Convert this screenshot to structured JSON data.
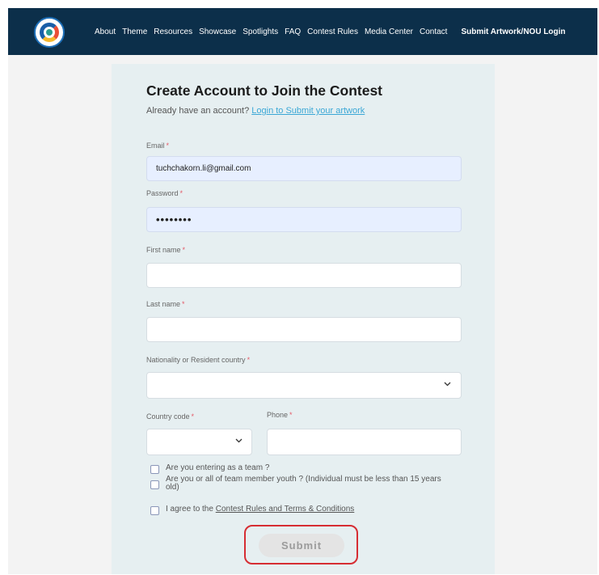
{
  "nav": {
    "items": [
      "About",
      "Theme",
      "Resources",
      "Showcase",
      "Spotlights",
      "FAQ",
      "Contest Rules",
      "Media Center",
      "Contact"
    ],
    "login": "Submit Artwork/NOU Login"
  },
  "form": {
    "title": "Create Account to Join the Contest",
    "already": "Already have an account?",
    "login_link": "Login to Submit your artwork",
    "email": {
      "label": "Email",
      "value": "tuchchakorn.li@gmail.com"
    },
    "password": {
      "label": "Password",
      "value": "••••••••"
    },
    "first_name": {
      "label": "First name",
      "value": ""
    },
    "last_name": {
      "label": "Last name",
      "value": ""
    },
    "nationality": {
      "label": "Nationality or Resident country",
      "value": ""
    },
    "country_code": {
      "label": "Country code",
      "value": ""
    },
    "phone": {
      "label": "Phone",
      "value": ""
    },
    "required_mark": "*",
    "team_q": "Are you entering as a team ?",
    "youth_q": "Are you or all of team member youth ? (Individual must be less than 15 years old)",
    "agree_prefix": "I agree to the",
    "agree_link": "Contest Rules and Terms & Conditions",
    "submit": "Submit"
  },
  "icons": {
    "logo": "contest-logo-icon",
    "dropdown": "chevron-down-icon"
  },
  "colors": {
    "navbar": "#0c2f4a",
    "card": "#e6eff1",
    "link": "#3aa7d6",
    "required": "#e45a67",
    "highlight": "#d62d33"
  }
}
